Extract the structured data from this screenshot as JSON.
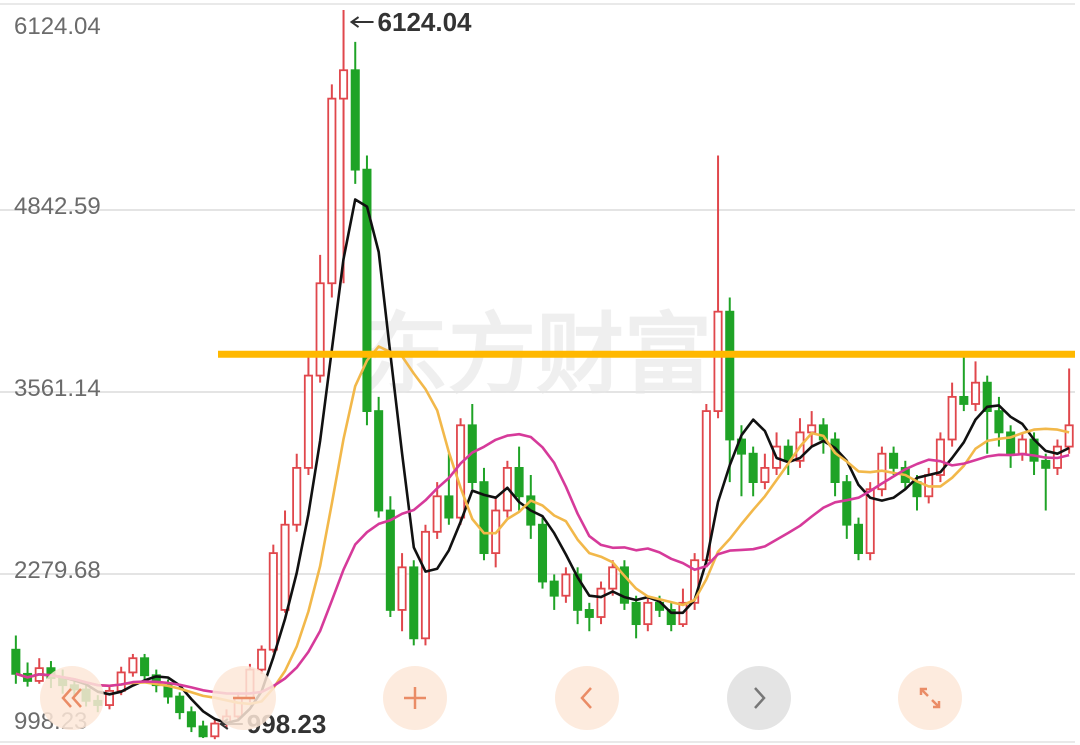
{
  "chart_data": {
    "type": "candlestick",
    "y_axis": {
      "tick_labels": [
        "6124.04",
        "4842.59",
        "3561.14",
        "2279.68",
        "998.23"
      ],
      "ylim": [
        998.23,
        6124.04
      ]
    },
    "annotations": {
      "high_label": "6124.04",
      "low_label": "998.23"
    },
    "reference_line": {
      "value": 3700,
      "color": "#FFB800"
    },
    "colors": {
      "up": "#E0474C",
      "down": "#1FA326",
      "ma_short": "#111111",
      "ma_mid": "#F2B84A",
      "ma_long": "#D63A9A"
    },
    "grid": true,
    "watermark": "东方财富",
    "candles": [
      [
        1620,
        1450,
        1720,
        1380
      ],
      [
        1450,
        1400,
        1530,
        1360
      ],
      [
        1400,
        1490,
        1560,
        1380
      ],
      [
        1490,
        1420,
        1540,
        1350
      ],
      [
        1420,
        1370,
        1480,
        1310
      ],
      [
        1370,
        1340,
        1420,
        1290
      ],
      [
        1340,
        1260,
        1380,
        1220
      ],
      [
        1260,
        1230,
        1300,
        1180
      ],
      [
        1230,
        1330,
        1360,
        1200
      ],
      [
        1330,
        1460,
        1500,
        1300
      ],
      [
        1460,
        1560,
        1590,
        1430
      ],
      [
        1560,
        1440,
        1590,
        1400
      ],
      [
        1440,
        1370,
        1480,
        1320
      ],
      [
        1370,
        1290,
        1410,
        1240
      ],
      [
        1290,
        1180,
        1320,
        1130
      ],
      [
        1180,
        1080,
        1220,
        1040
      ],
      [
        1080,
        1010,
        1120,
        998
      ],
      [
        1010,
        1100,
        1140,
        990
      ],
      [
        1100,
        1150,
        1200,
        1070
      ],
      [
        1150,
        1280,
        1320,
        1120
      ],
      [
        1280,
        1480,
        1520,
        1250
      ],
      [
        1480,
        1620,
        1650,
        1450
      ],
      [
        1620,
        2300,
        2360,
        1600
      ],
      [
        1900,
        2500,
        2600,
        1880
      ],
      [
        2500,
        2900,
        3000,
        2450
      ],
      [
        2900,
        3550,
        3700,
        2850
      ],
      [
        3550,
        4200,
        4400,
        3500
      ],
      [
        4200,
        5500,
        5600,
        4100
      ],
      [
        5500,
        5700,
        6124,
        4200
      ],
      [
        5700,
        5000,
        5900,
        4900
      ],
      [
        5000,
        3300,
        5100,
        3200
      ],
      [
        3300,
        2600,
        3400,
        2550
      ],
      [
        2600,
        1900,
        2700,
        1850
      ],
      [
        1900,
        2200,
        2300,
        1750
      ],
      [
        2200,
        1700,
        2250,
        1650
      ],
      [
        1700,
        2450,
        2500,
        1650
      ],
      [
        2450,
        2700,
        2800,
        2400
      ],
      [
        2700,
        2550,
        3000,
        2500
      ],
      [
        2550,
        3200,
        3250,
        2500
      ],
      [
        3200,
        2800,
        3350,
        2750
      ],
      [
        2800,
        2300,
        2900,
        2250
      ],
      [
        2300,
        2600,
        2700,
        2200
      ],
      [
        2600,
        2900,
        2950,
        2550
      ],
      [
        2900,
        2700,
        3050,
        2600
      ],
      [
        2700,
        2500,
        2850,
        2400
      ],
      [
        2500,
        2100,
        2550,
        2050
      ],
      [
        2100,
        2000,
        2150,
        1900
      ],
      [
        2000,
        2150,
        2200,
        1950
      ],
      [
        2150,
        1900,
        2200,
        1800
      ],
      [
        1900,
        1850,
        1950,
        1750
      ],
      [
        1850,
        2050,
        2100,
        1800
      ],
      [
        2050,
        2200,
        2250,
        2000
      ],
      [
        2200,
        1950,
        2250,
        1900
      ],
      [
        1950,
        1800,
        2000,
        1700
      ],
      [
        1800,
        1950,
        2000,
        1750
      ],
      [
        1950,
        1900,
        2000,
        1850
      ],
      [
        1900,
        1800,
        1950,
        1750
      ],
      [
        1800,
        1950,
        2050,
        1780
      ],
      [
        1950,
        2250,
        2300,
        1900
      ],
      [
        2250,
        3300,
        3350,
        2200
      ],
      [
        3300,
        4000,
        5100,
        3250
      ],
      [
        4000,
        3100,
        4100,
        2800
      ],
      [
        3100,
        3000,
        3200,
        2700
      ],
      [
        3000,
        2800,
        3050,
        2700
      ],
      [
        2800,
        2900,
        3000,
        2750
      ],
      [
        2900,
        3050,
        3150,
        2850
      ],
      [
        3050,
        2950,
        3100,
        2850
      ],
      [
        2950,
        3150,
        3250,
        2900
      ],
      [
        3150,
        3200,
        3300,
        3050
      ],
      [
        3200,
        3100,
        3250,
        3000
      ],
      [
        3100,
        2800,
        3150,
        2700
      ],
      [
        2800,
        2500,
        2850,
        2400
      ],
      [
        2500,
        2300,
        2550,
        2250
      ],
      [
        2300,
        2750,
        2800,
        2250
      ],
      [
        2750,
        3000,
        3050,
        2700
      ],
      [
        3000,
        2900,
        3050,
        2850
      ],
      [
        2900,
        2800,
        2950,
        2750
      ],
      [
        2800,
        2700,
        2850,
        2600
      ],
      [
        2700,
        2850,
        2900,
        2650
      ],
      [
        2850,
        3100,
        3150,
        2800
      ],
      [
        3100,
        3400,
        3500,
        3050
      ],
      [
        3400,
        3350,
        3700,
        3300
      ],
      [
        3350,
        3500,
        3650,
        3300
      ],
      [
        3500,
        3300,
        3550,
        3000
      ],
      [
        3300,
        3150,
        3400,
        3050
      ],
      [
        3150,
        3000,
        3200,
        2900
      ],
      [
        3000,
        3100,
        3150,
        2950
      ],
      [
        3100,
        2950,
        3150,
        2850
      ],
      [
        2950,
        2900,
        3000,
        2600
      ],
      [
        2900,
        3050,
        3100,
        2850
      ],
      [
        3050,
        3200,
        3600,
        3000
      ]
    ]
  },
  "toolbar": {
    "items": [
      {
        "label": "«"
      },
      {
        "label": "−"
      },
      {
        "label": "+"
      },
      {
        "label": "‹"
      },
      {
        "label": "›"
      },
      {
        "label": "fullscreen"
      }
    ]
  }
}
